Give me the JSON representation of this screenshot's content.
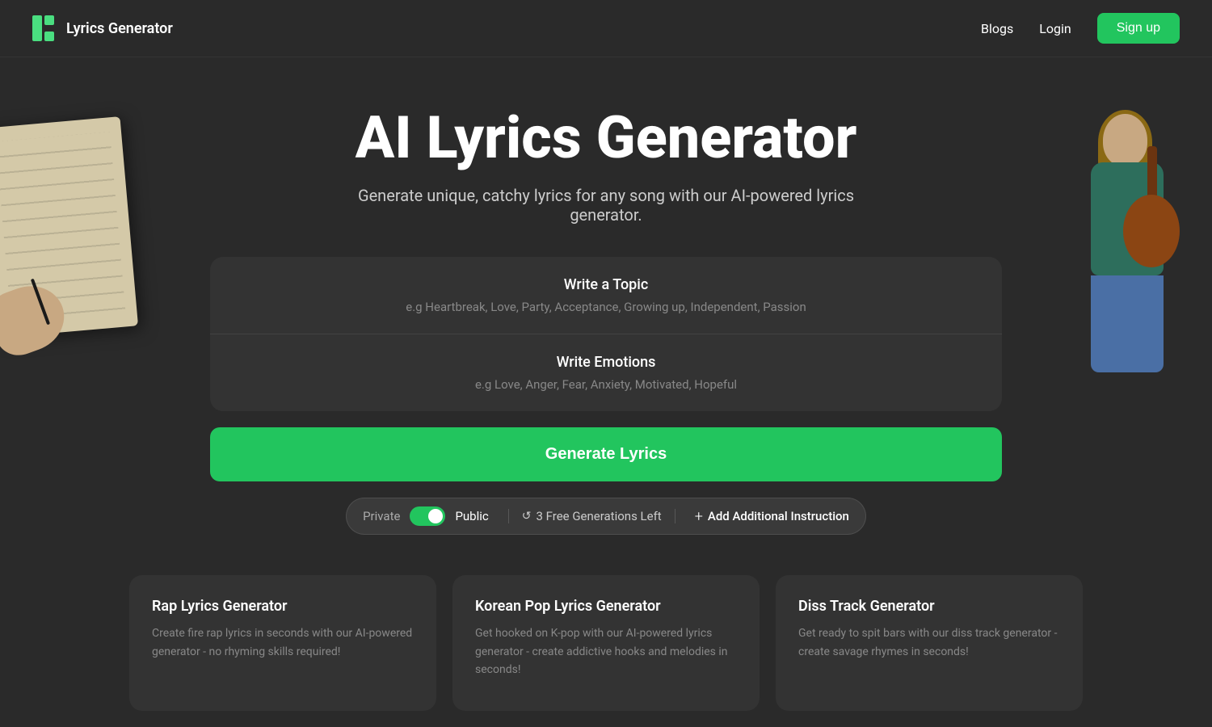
{
  "navbar": {
    "logo_text": "Lyrics Generator",
    "blogs_label": "Blogs",
    "login_label": "Login",
    "signup_label": "Sign up"
  },
  "hero": {
    "title": "AI Lyrics Generator",
    "subtitle": "Generate unique, catchy lyrics for any song with our AI-powered lyrics generator."
  },
  "form": {
    "topic_label": "Write a Topic",
    "topic_placeholder": "e.g Heartbreak, Love, Party, Acceptance, Growing up, Independent, Passion",
    "emotions_label": "Write Emotions",
    "emotions_placeholder": "e.g Love, Anger, Fear, Anxiety, Motivated, Hopeful"
  },
  "generate_button": {
    "label": "Generate Lyrics"
  },
  "controls": {
    "private_label": "Private",
    "public_label": "Public",
    "generations_left": "3 Free Generations Left",
    "add_instruction_label": "Add Additional Instruction"
  },
  "cards": [
    {
      "title": "Rap Lyrics Generator",
      "description": "Create fire rap lyrics in seconds with our AI-powered generator - no rhyming skills required!"
    },
    {
      "title": "Korean Pop Lyrics Generator",
      "description": "Get hooked on K-pop with our AI-powered lyrics generator - create addictive hooks and melodies in seconds!"
    },
    {
      "title": "Diss Track Generator",
      "description": "Get ready to spit bars with our diss track generator - create savage rhymes in seconds!"
    }
  ],
  "colors": {
    "primary_green": "#22c55e",
    "bg_dark": "#2a2a2a",
    "card_bg": "#333333",
    "text_muted": "#888888"
  },
  "icons": {
    "logo": "bars-icon",
    "refresh": "↺",
    "plus": "+"
  }
}
